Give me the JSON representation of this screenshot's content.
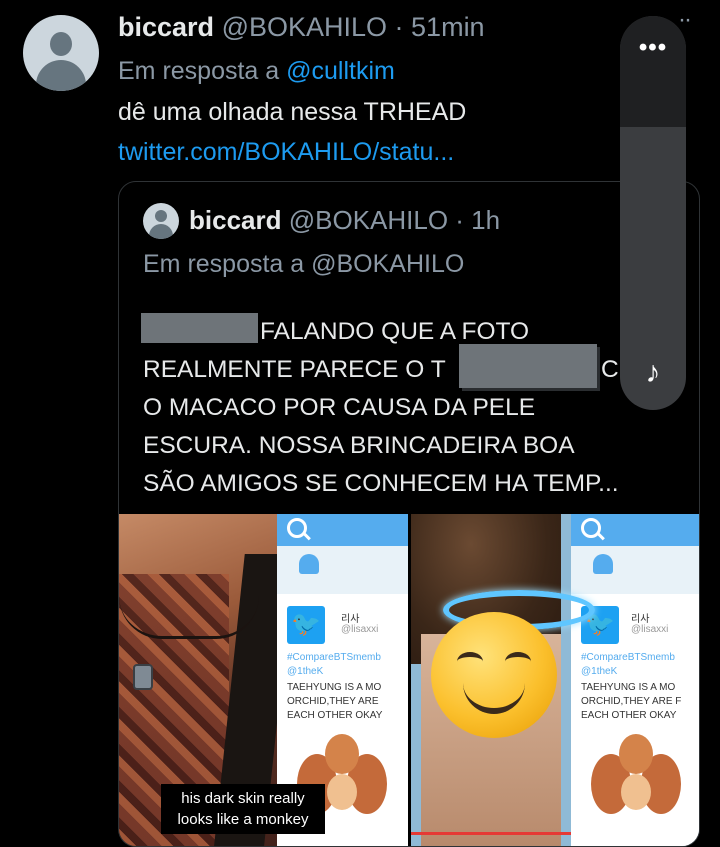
{
  "tweet": {
    "author_name": "biccard",
    "author_handle": "@BOKAHILO",
    "time": "· 51min",
    "reply_prefix": "Em resposta a",
    "reply_to": "@culltkim",
    "text": "dê uma olhada nessa TRHEAD",
    "link": "twitter.com/BOKAHILO/statu..."
  },
  "quoted": {
    "author_name": "biccard",
    "author_handle": "@BOKAHILO",
    "time": "· 1h",
    "reply_text": "Em resposta a @BOKAHILO",
    "lines": [
      "FALANDO QUE A FOTO",
      "REALMENTE PARECE O T",
      "O MACACO POR CAUSA DA PELE",
      "ESCURA. NOSSA BRINCADEIRA BOA",
      "SÃO AMIGOS SE CONHECEM HA TEMP..."
    ],
    "line2_tail": "C"
  },
  "images": {
    "caption_line1": "his dark skin really",
    "caption_line2": "looks like a monkey",
    "tweet_card": {
      "account": "리사",
      "handle": "@lisaxxi",
      "hashtag": "#CompareBTSmemb",
      "mention": "@1theK",
      "line1": "TAEHYUNG IS A MO",
      "line2": "ORCHID,THEY ARE",
      "line3": "EACH OTHER OKAY"
    },
    "tweet_card_right": {
      "account": "리사",
      "handle": "@lisaxxi",
      "hashtag": "#CompareBTSmemb",
      "mention": "@1theK",
      "line1": "TAEHYUNG IS A MO",
      "line2": "ORCHID,THEY ARE F",
      "line3": "EACH OTHER OKAY"
    }
  },
  "overlay": {
    "more_label": "•••",
    "audio_icon": "♪"
  },
  "top_more": "··"
}
